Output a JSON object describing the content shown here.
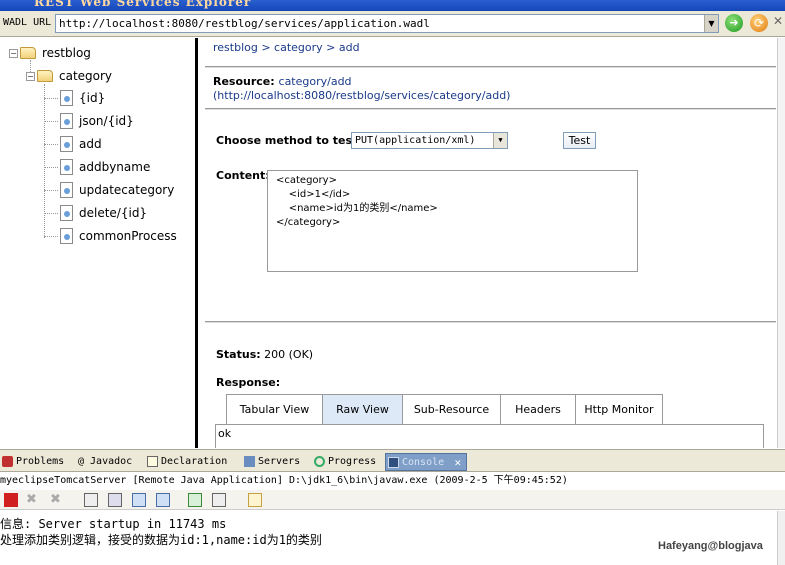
{
  "window": {
    "title": "REST Web Services Explorer"
  },
  "urlbar": {
    "label": "WADL URL",
    "value": "http://localhost:8080/restblog/services/application.wadl"
  },
  "tree": {
    "root": "restblog",
    "folder": "category",
    "items": [
      "{id}",
      "json/{id}",
      "add",
      "addbyname",
      "updatecategory",
      "delete/{id}",
      "commonProcess"
    ]
  },
  "main": {
    "breadcrumb": "restblog > category > add",
    "resource_label": "Resource:",
    "resource_path": "category/add",
    "resource_url": "(http://localhost:8080/restblog/services/category/add)",
    "method_label": "Choose method to test:",
    "method_value": "PUT(application/xml)",
    "test_button": "Test",
    "content_label": "Content:",
    "content_lines": [
      "<category>",
      "    <id>1</id>",
      "    <name>id为1的类别</name>",
      "</category>"
    ],
    "status_label": "Status:",
    "status_value": "200 (OK)",
    "response_label": "Response:",
    "tabs": [
      "Tabular View",
      "Raw View",
      "Sub-Resource",
      "Headers",
      "Http Monitor"
    ],
    "active_tab": "Raw View",
    "response_body": "ok"
  },
  "eclipse": {
    "tabs": [
      "Problems",
      "@ Javadoc",
      "Declaration",
      "Servers",
      "Progress",
      "Console"
    ],
    "active_tab": "Console",
    "console_header": "myeclipseTomcatServer [Remote Java Application] D:\\jdk1_6\\bin\\javaw.exe (2009-2-5 下午09:45:52)",
    "output_lines": [
      "信息: Server startup in 11743 ms",
      "处理添加类别逻辑，接受的数据为id:1,name:id为1的类别"
    ],
    "watermark": "Hafeyang@blogjava"
  },
  "colors": {
    "link": "#1a3a8a",
    "active_tab": "#7f9fc8",
    "title_bar": "#2a5fd0"
  }
}
